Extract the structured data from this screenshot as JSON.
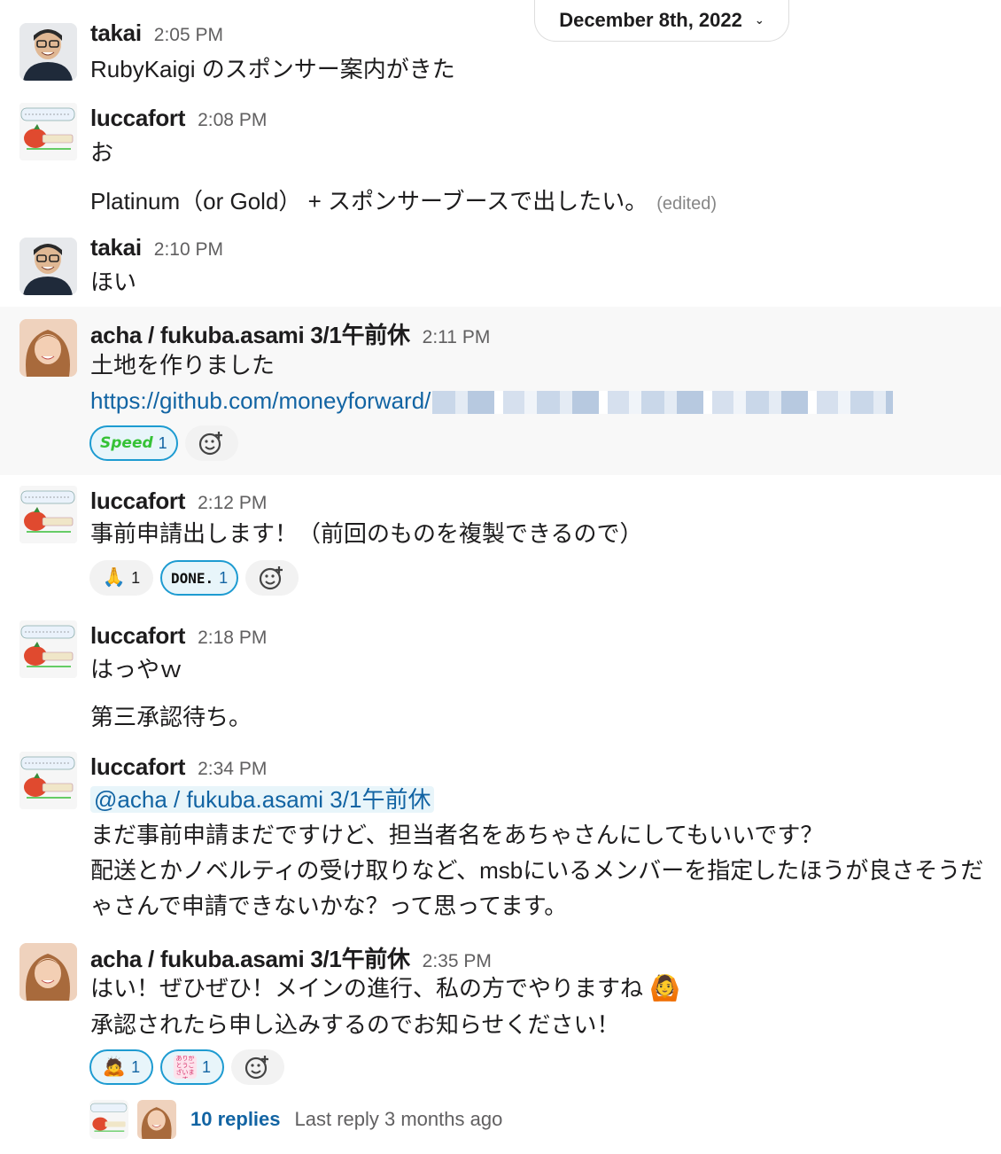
{
  "date_divider": {
    "label": "December 8th, 2022"
  },
  "messages": [
    {
      "author": "takai",
      "time": "2:05 PM",
      "lines": [
        "RubyKaigi のスポンサー案内がきた"
      ]
    },
    {
      "author": "luccafort",
      "time": "2:08 PM",
      "lines": [
        "お",
        "Platinum（or Gold） + スポンサーブースで出したい。"
      ],
      "edited": "(edited)"
    },
    {
      "author": "takai",
      "time": "2:10 PM",
      "lines": [
        "ほい"
      ]
    },
    {
      "author": "acha / fukuba.asami 3/1午前休",
      "time": "2:11 PM",
      "lines": [
        "土地を作りました"
      ],
      "link": "https://github.com/moneyforward/",
      "reactions": [
        {
          "emoji": "speed",
          "label": "Speed",
          "count": "1",
          "mine": true
        }
      ]
    },
    {
      "author": "luccafort",
      "time": "2:12 PM",
      "lines": [
        "事前申請出します！（前回のものを複製できるので）"
      ],
      "reactions": [
        {
          "emoji": "pray",
          "label": "🙏",
          "count": "1",
          "mine": false
        },
        {
          "emoji": "done",
          "label": "DONE.",
          "count": "1",
          "mine": true
        }
      ]
    },
    {
      "author": "luccafort",
      "time": "2:18 PM",
      "lines": [
        "はっやｗ",
        "第三承認待ち。"
      ]
    },
    {
      "author": "luccafort",
      "time": "2:34 PM",
      "mention": "@acha / fukuba.asami 3/1午前休",
      "lines": [
        "まだ事前申請まだですけど、担当者名をあちゃさんにしてもいいです？",
        "配送とかノベルティの受け取りなど、msbにいるメンバーを指定したほうが良さそうだ",
        "ゃさんで申請できないかな？って思ってます。"
      ]
    },
    {
      "author": "acha / fukuba.asami 3/1午前休",
      "time": "2:35 PM",
      "lines": [
        "はい！ぜひぜひ！メインの進行、私の方でやりますね",
        "承認されたら申し込みするのでお知らせください！"
      ],
      "trailing_emoji": "🙆",
      "reactions": [
        {
          "emoji": "bow",
          "label": "🙇",
          "count": "1",
          "mine": true
        },
        {
          "emoji": "arigatou",
          "label": "ありがとうございます",
          "count": "1",
          "mine": true
        }
      ]
    }
  ],
  "thread": {
    "replies": "10 replies",
    "last_reply": "Last reply 3 months ago"
  },
  "colors": {
    "link": "#1264a3",
    "highlight_bg": "#f8f8f8",
    "reaction_border": "#1d9bd1"
  }
}
